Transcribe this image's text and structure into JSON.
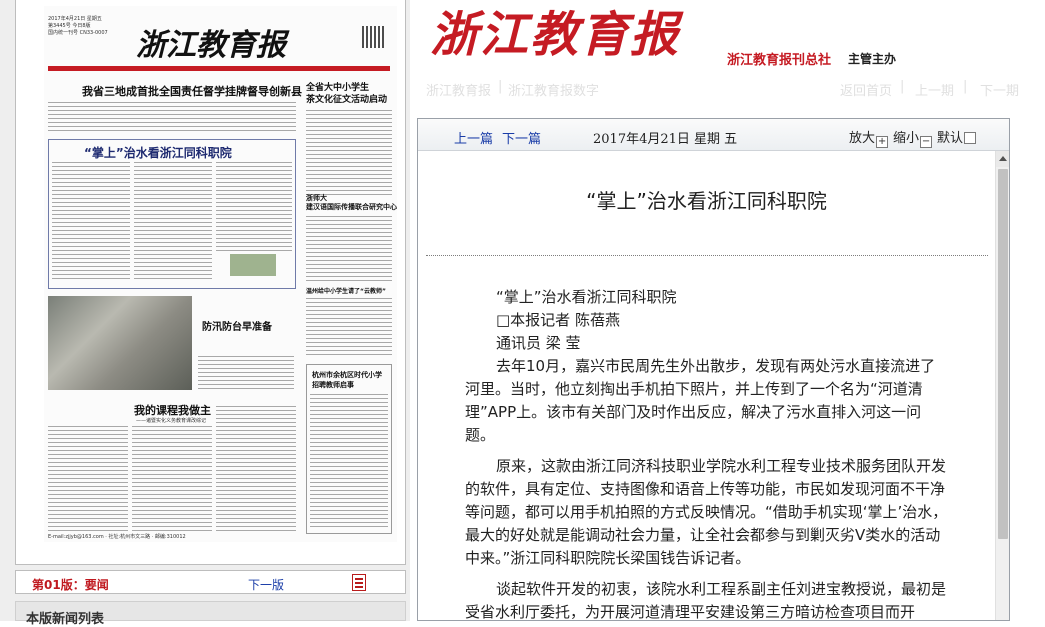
{
  "newspaper": {
    "masthead": "浙江教育报",
    "date_line": "2017年4月21日 星期五",
    "issue_line": "第3445号 今日8版",
    "cn_line": "国内统一刊号 CN33-0007",
    "headline_main": "我省三地成首批全国责任督学挂牌督导创新县",
    "headline_right": "全省大中小学生\n茶文化征文活动启动",
    "headline_boxed": "“掌上”治水看浙江同科职院",
    "headline_mid": "浙师大\n建汉语国际传播联合研究中心",
    "headline_wenzhou": "温州给中小学生请了“云教师”",
    "headline_flood": "防汛防台早准备",
    "headline_course": "我的课程我做主",
    "headline_course_sub": "——诸暨实化义务教育课改综记",
    "headline_ad": "杭州市余杭区时代小学\n招聘教师启事",
    "footer_line": "E-mail:zjjyb@163.com  · 社址:杭州市文三路 · 邮编:310012"
  },
  "page_nav": {
    "page_label": "第01版：要闻",
    "next_page": "下一版",
    "pdf_icon": "pdf-icon"
  },
  "news_list": {
    "title": "本版新闻列表"
  },
  "header": {
    "masthead": "浙江教育报",
    "publisher": "浙江教育报刊总社",
    "supervisor": "主管主办"
  },
  "topnav": {
    "items": [
      "浙江教育报",
      "浙江教育报数字",
      "返回首页",
      "上一期",
      "下一期"
    ]
  },
  "toolbar": {
    "prev": "上一篇",
    "next": "下一篇",
    "date": "2017年4月21日  星期 五",
    "zoom_in": "放大",
    "zoom_out": "缩小",
    "default": "默认",
    "zoom_in_symbol": "+",
    "zoom_out_symbol": "−"
  },
  "article": {
    "title": "“掌上”治水看浙江同科职院",
    "subtitle": "“掌上”治水看浙江同科职院",
    "byline1": "□本报记者 陈蓓燕",
    "byline2": "通讯员 梁 莹",
    "para1": "去年10月，嘉兴市民周先生外出散步，发现有两处污水直接流进了河里。当时，他立刻掏出手机拍下照片，并上传到了一个名为“河道清理”APP上。该市有关部门及时作出反应，解决了污水直排入河这一问题。",
    "para2": "原来，这款由浙江同济科技职业学院水利工程专业技术服务团队开发的软件，具有定位、支持图像和语音上传等功能，市民如发现河面不干净等问题，都可以用手机拍照的方式反映情况。“借助手机实现‘掌上’治水，最大的好处就是能调动社会力量，让全社会都参与到剿灭劣Ⅴ类水的活动中来。”浙江同科职院院长梁国钱告诉记者。",
    "para3": "谈起软件开发的初衷，该院水利工程系副主任刘进宝教授说，最初是受省水利厅委托，为开展河道清理平安建设第三方暗访检查项目而开发。“考虑到全省水流河系众多，仅仅依靠师生的力量难以集齐全部信"
  }
}
